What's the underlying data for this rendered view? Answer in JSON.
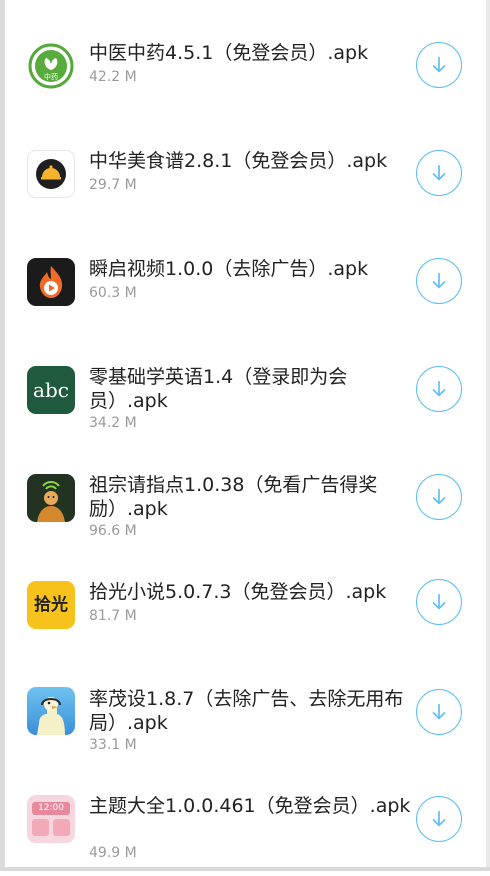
{
  "items": [
    {
      "title": "中医中药4.5.1（免登会员）.apk",
      "size": "42.2 M",
      "icon": "leaf-app-icon",
      "icon_text": "中药"
    },
    {
      "title": "中华美食谱2.8.1（免登会员）.apk",
      "size": "29.7 M",
      "icon": "dish-cover-icon"
    },
    {
      "title": "瞬启视频1.0.0（去除广告）.apk",
      "size": "60.3 M",
      "icon": "flame-play-icon"
    },
    {
      "title": "零基础学英语1.4（登录即为会员）.apk",
      "size": "34.2 M",
      "icon": "abc-app-icon",
      "icon_text": "abc"
    },
    {
      "title": "祖宗请指点1.0.38（免看广告得奖励）.apk",
      "size": "96.6 M",
      "icon": "ancestor-app-icon"
    },
    {
      "title": "拾光小说5.0.7.3（免登会员）.apk",
      "size": "81.7 M",
      "icon": "shiguang-app-icon",
      "icon_text": "拾光"
    },
    {
      "title": "率茂设1.8.7（去除广告、去除无用布局）.apk",
      "size": "33.1 M",
      "icon": "duck-app-icon"
    },
    {
      "title": "主题大全1.0.0.461（免登会员）.apk",
      "size": "49.9 M",
      "icon": "theme-app-icon",
      "icon_text": "12:00"
    }
  ]
}
